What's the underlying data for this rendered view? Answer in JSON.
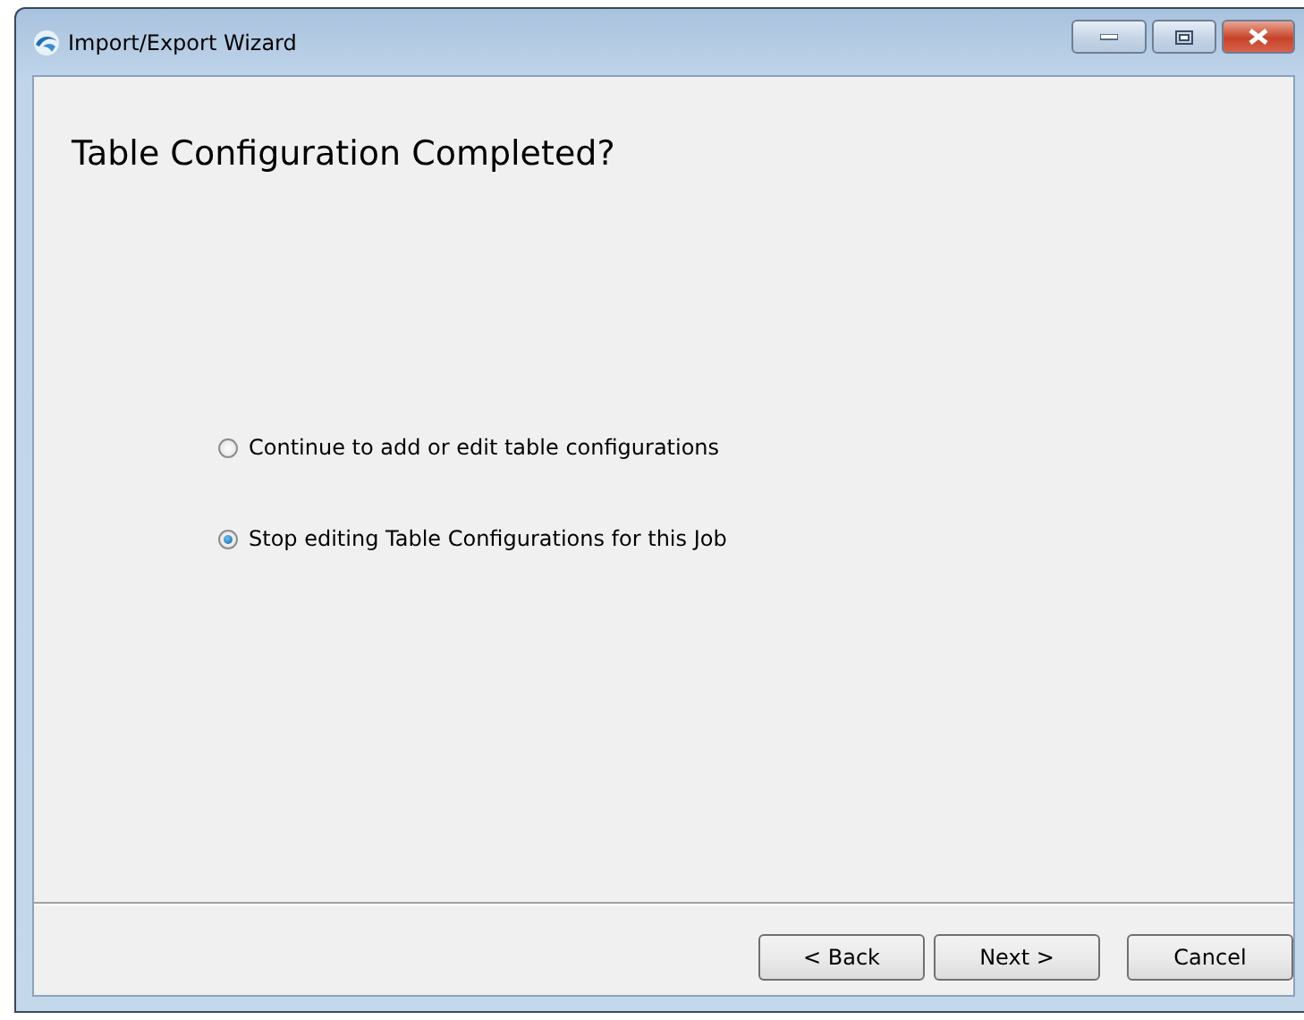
{
  "window": {
    "title": "Import/Export Wizard",
    "controls": [
      {
        "kind": "minimize"
      },
      {
        "kind": "maximize"
      },
      {
        "kind": "close"
      }
    ]
  },
  "heading": "Table Configuration Completed?",
  "options": [
    {
      "label": "Continue to add or edit table configurations",
      "selected": false
    },
    {
      "label": "Stop editing Table Configurations for this Job",
      "selected": true
    }
  ],
  "buttons": [
    {
      "label": "< Back",
      "kind": "back"
    },
    {
      "label": "Next >",
      "kind": "next"
    },
    {
      "label": "Cancel",
      "kind": "cancel"
    }
  ]
}
